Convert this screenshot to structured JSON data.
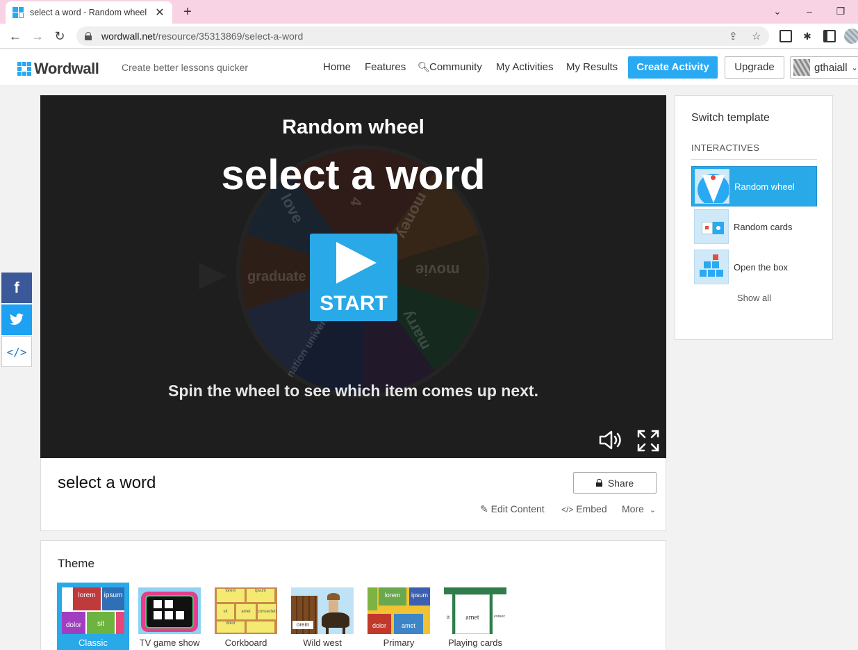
{
  "browser": {
    "tab_title": "select a word - Random wheel",
    "url_host": "wordwall.net",
    "url_path": "/resource/35313869/select-a-word"
  },
  "header": {
    "logo": "Wordwall",
    "tagline": "Create better lessons quicker",
    "nav": [
      "Home",
      "Features",
      "Community",
      "My Activities",
      "My Results"
    ],
    "create_label": "Create Activity",
    "upgrade_label": "Upgrade",
    "username": "gthaiall"
  },
  "game": {
    "template_name": "Random wheel",
    "title": "select a word",
    "start_label": "START",
    "instructions": "Spin the wheel to see which item comes up next.",
    "wheel_words": [
      "love",
      "4",
      "money",
      "movie",
      "marry",
      "nation university",
      "graduate"
    ]
  },
  "activity": {
    "title": "select a word",
    "share_label": "Share",
    "edit_label": "Edit Content",
    "embed_label": "Embed",
    "more_label": "More"
  },
  "theme": {
    "heading": "Theme",
    "items": [
      "Classic",
      "TV game show",
      "Corkboard",
      "Wild west",
      "Primary",
      "Playing cards"
    ],
    "selected": "Classic",
    "thumb_words": {
      "classic": [
        "lorem",
        "ipsum",
        "dolor",
        "sit"
      ],
      "corkboard": [
        "lorem",
        "ipsum",
        "dolor",
        "sit",
        "amet",
        "consectetur"
      ],
      "wildwest": [
        "orem"
      ],
      "primary": [
        "lorem",
        "ipsum",
        "dolor",
        "amet"
      ],
      "cards": [
        "it",
        "amet",
        "consec"
      ]
    }
  },
  "switch_panel": {
    "heading": "Switch template",
    "section": "INTERACTIVES",
    "templates": [
      "Random wheel",
      "Random cards",
      "Open the box"
    ],
    "show_all": "Show all"
  },
  "colors": {
    "accent": "#2aa9f3",
    "game_bg": "#1e1e1e",
    "tab_strip": "#f7d3e3"
  }
}
